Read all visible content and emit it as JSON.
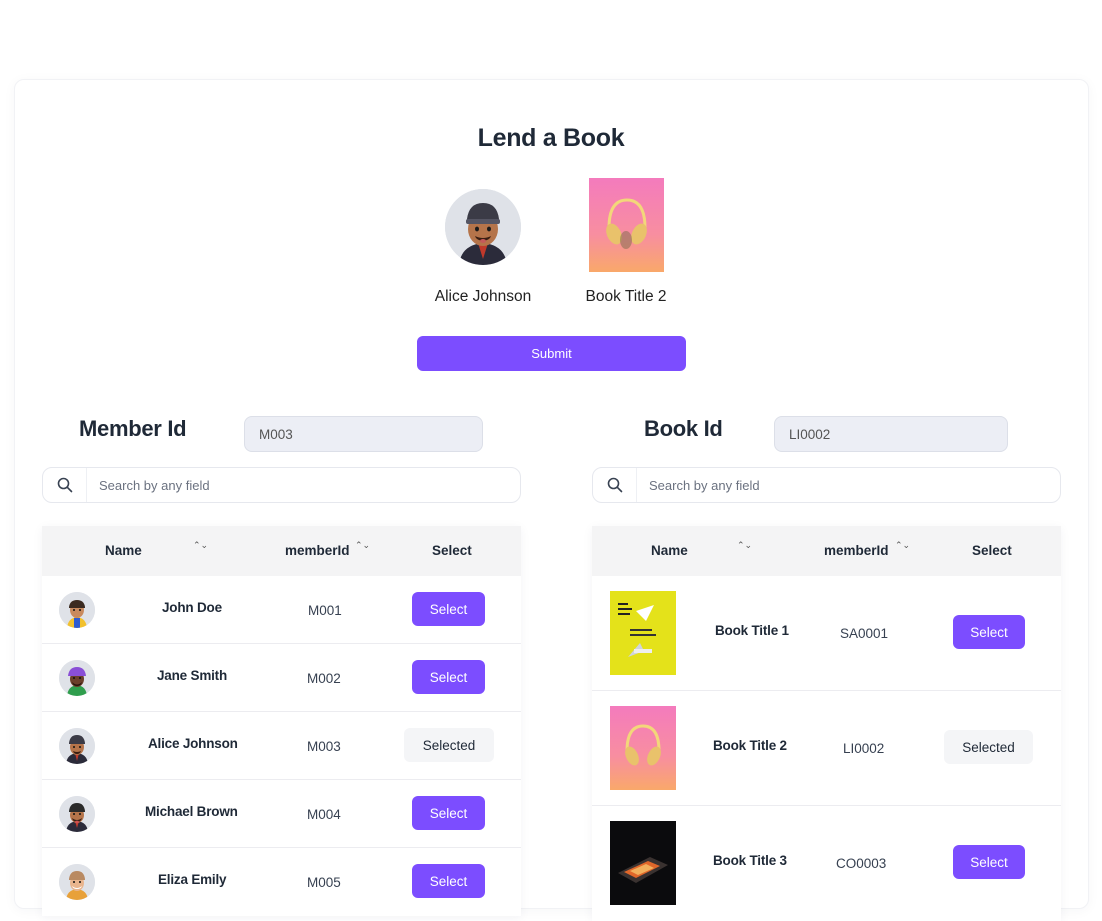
{
  "title": "Lend a Book",
  "selected": {
    "member_name": "Alice Johnson",
    "book_title": "Book Title 2"
  },
  "submit_label": "Submit",
  "members": {
    "label": "Member Id",
    "id_value": "M003",
    "search_placeholder": "Search by any field",
    "columns": [
      "Name",
      "memberId",
      "Select"
    ],
    "sort_glyph": "⌃⌄",
    "rows": [
      {
        "name": "John Doe",
        "id": "M001",
        "action": "Select"
      },
      {
        "name": "Jane Smith",
        "id": "M002",
        "action": "Select"
      },
      {
        "name": "Alice Johnson",
        "id": "M003",
        "action": "Selected"
      },
      {
        "name": "Michael Brown",
        "id": "M004",
        "action": "Select"
      },
      {
        "name": "Eliza Emily",
        "id": "M005",
        "action": "Select"
      }
    ]
  },
  "books": {
    "label": "Book Id",
    "id_value": "LI0002",
    "search_placeholder": "Search by any field",
    "columns": [
      "Name",
      "memberId",
      "Select"
    ],
    "rows": [
      {
        "name": "Book Title 1",
        "id": "SA0001",
        "action": "Select"
      },
      {
        "name": "Book Title 2",
        "id": "LI0002",
        "action": "Selected"
      },
      {
        "name": "Book Title 3",
        "id": "CO0003",
        "action": "Select"
      }
    ]
  },
  "colors": {
    "accent": "#7c4dff",
    "header_bg": "#f4f4f5",
    "input_bg": "#eceef5"
  },
  "icons": [
    "search-icon",
    "sort-icon",
    "avatar",
    "book-cover"
  ]
}
